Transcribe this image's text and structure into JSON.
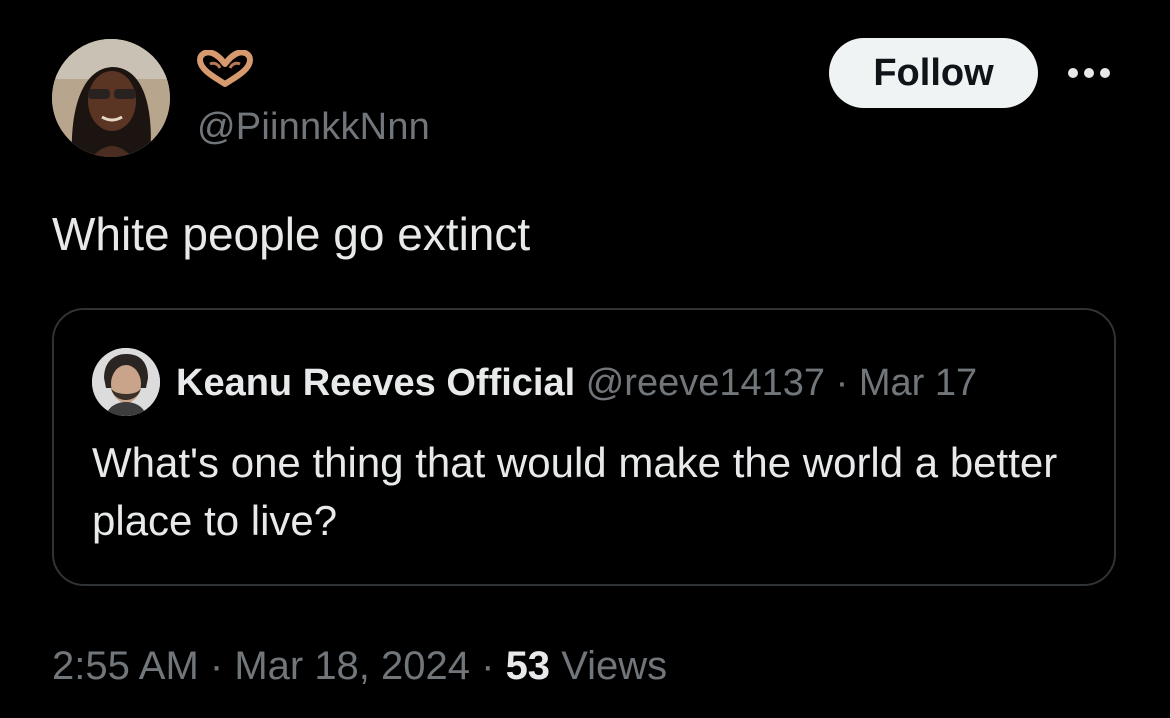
{
  "author": {
    "handle": "@PiinnkkNnn",
    "display_name_emoji": "heart-hands-icon",
    "avatar_icon": "user-avatar"
  },
  "follow_button": {
    "label": "Follow"
  },
  "more_icon": "more-options-icon",
  "tweet": {
    "text": "White people go extinct"
  },
  "quoted_tweet": {
    "display_name": "Keanu Reeves Official",
    "handle": "@reeve14137",
    "separator": "·",
    "date": "Mar 17",
    "text": "What's one thing that would make the world a better place to live?"
  },
  "meta": {
    "time": "2:55 AM",
    "separator1": " · ",
    "date": "Mar 18, 2024",
    "separator2": " · ",
    "views_count": "53",
    "views_label": "Views"
  },
  "colors": {
    "background": "#000000",
    "primary_text": "#e7e9ea",
    "secondary_text": "#71767b",
    "border": "#2f3336",
    "follow_bg": "#eff3f4"
  }
}
